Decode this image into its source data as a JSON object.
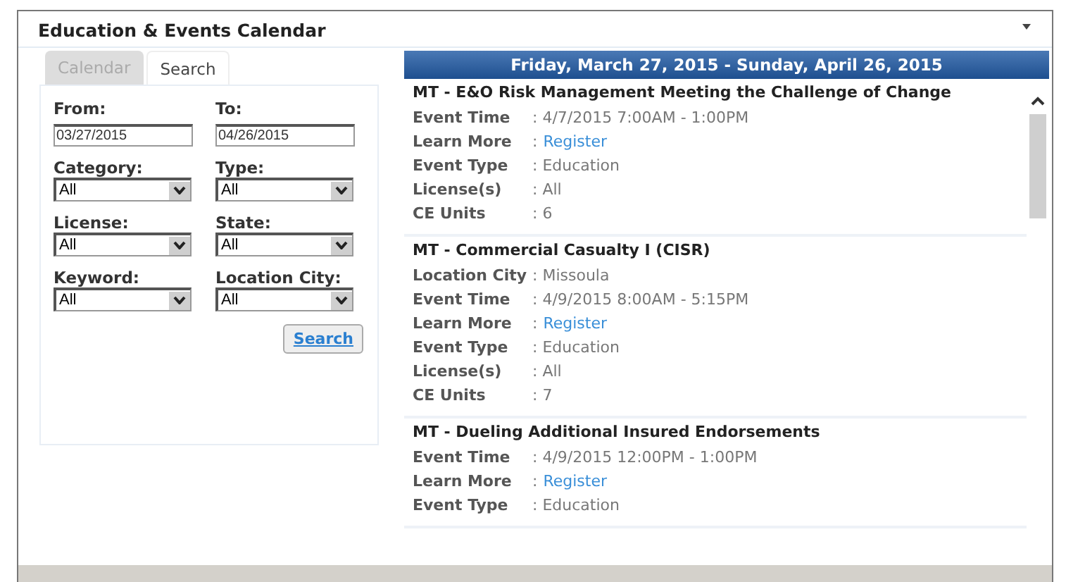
{
  "panel": {
    "title": "Education & Events Calendar"
  },
  "tabs": [
    {
      "label": "Calendar",
      "selected": false
    },
    {
      "label": "Search",
      "selected": true
    }
  ],
  "form": {
    "fields": [
      {
        "label": "From:",
        "kind": "text",
        "value": "03/27/2015"
      },
      {
        "label": "To:",
        "kind": "text",
        "value": "04/26/2015"
      },
      {
        "label": "Category:",
        "kind": "select",
        "value": "All"
      },
      {
        "label": "Type:",
        "kind": "select",
        "value": "All"
      },
      {
        "label": "License:",
        "kind": "select",
        "value": "All"
      },
      {
        "label": "State:",
        "kind": "select",
        "value": "All"
      },
      {
        "label": "Keyword:",
        "kind": "select",
        "value": "All"
      },
      {
        "label": "Location City:",
        "kind": "select",
        "value": "All"
      }
    ],
    "button": "Search"
  },
  "results": {
    "range": "Friday, March 27, 2015 - Sunday, April 26, 2015",
    "events": [
      {
        "title": "MT - E&O Risk Management Meeting the Challenge of Change",
        "rows": [
          {
            "label": "Event Time",
            "value": ": 4/7/2015 7:00AM - 1:00PM",
            "kind": "text"
          },
          {
            "label": "Learn More",
            "prefix": ":",
            "value": "Register",
            "kind": "link"
          },
          {
            "label": "Event Type",
            "value": ": Education",
            "kind": "text"
          },
          {
            "label": "License(s)",
            "value": ": All",
            "kind": "text"
          },
          {
            "label": "CE Units",
            "value": ": 6",
            "kind": "text"
          }
        ]
      },
      {
        "title": "MT - Commercial Casualty I (CISR)",
        "rows": [
          {
            "label": "Location City",
            "value": ": Missoula",
            "kind": "text"
          },
          {
            "label": "Event Time",
            "value": ": 4/9/2015 8:00AM - 5:15PM",
            "kind": "text"
          },
          {
            "label": "Learn More",
            "prefix": ":",
            "value": "Register",
            "kind": "link"
          },
          {
            "label": "Event Type",
            "value": ": Education",
            "kind": "text"
          },
          {
            "label": "License(s)",
            "value": ": All",
            "kind": "text"
          },
          {
            "label": "CE Units",
            "value": ": 7",
            "kind": "text"
          }
        ]
      },
      {
        "title": "MT - Dueling Additional Insured Endorsements",
        "rows": [
          {
            "label": "Event Time",
            "value": ": 4/9/2015 12:00PM - 1:00PM",
            "kind": "text"
          },
          {
            "label": "Learn More",
            "prefix": ":",
            "value": "Register",
            "kind": "link"
          },
          {
            "label": "Event Type",
            "value": ": Education",
            "kind": "text"
          }
        ]
      }
    ]
  }
}
